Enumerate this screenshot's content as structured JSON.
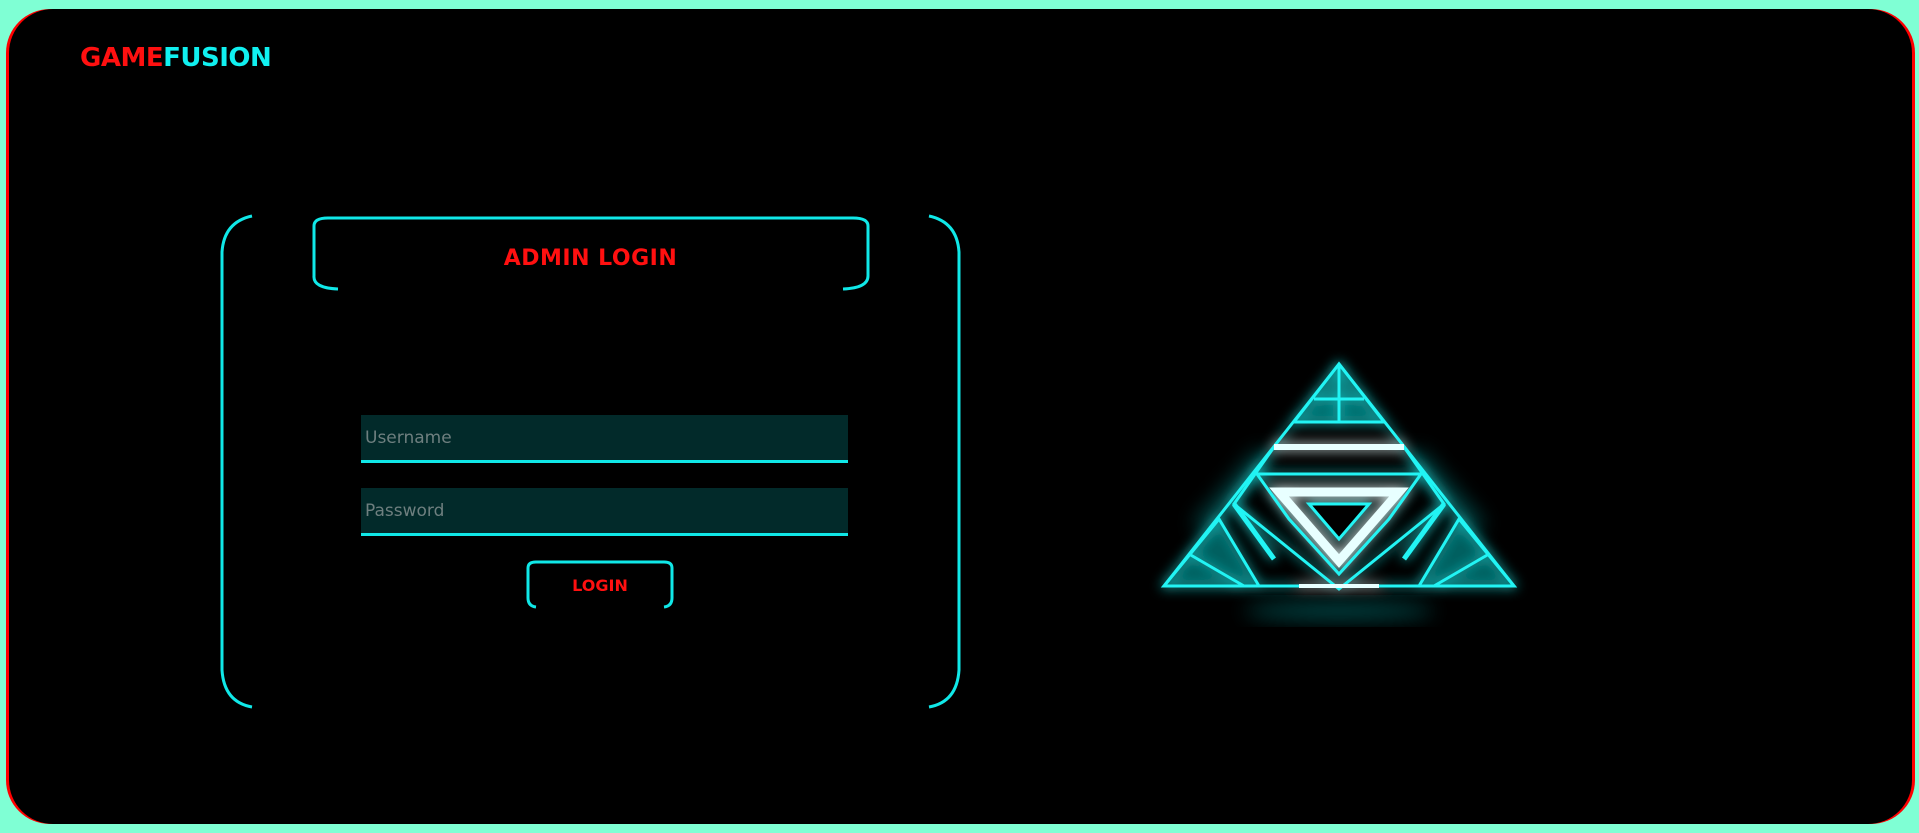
{
  "brand": {
    "part1": "GAME",
    "part2": "FUSION"
  },
  "login": {
    "title": "ADMIN LOGIN",
    "username_placeholder": "Username",
    "password_placeholder": "Password",
    "submit_label": "LOGIN"
  },
  "colors": {
    "page_border": "#7fffd4",
    "background": "#000000",
    "accent_cyan": "#10f0f0",
    "accent_red": "#ff1010"
  },
  "icons": {
    "logo": "neon-triangle-emblem-icon"
  }
}
